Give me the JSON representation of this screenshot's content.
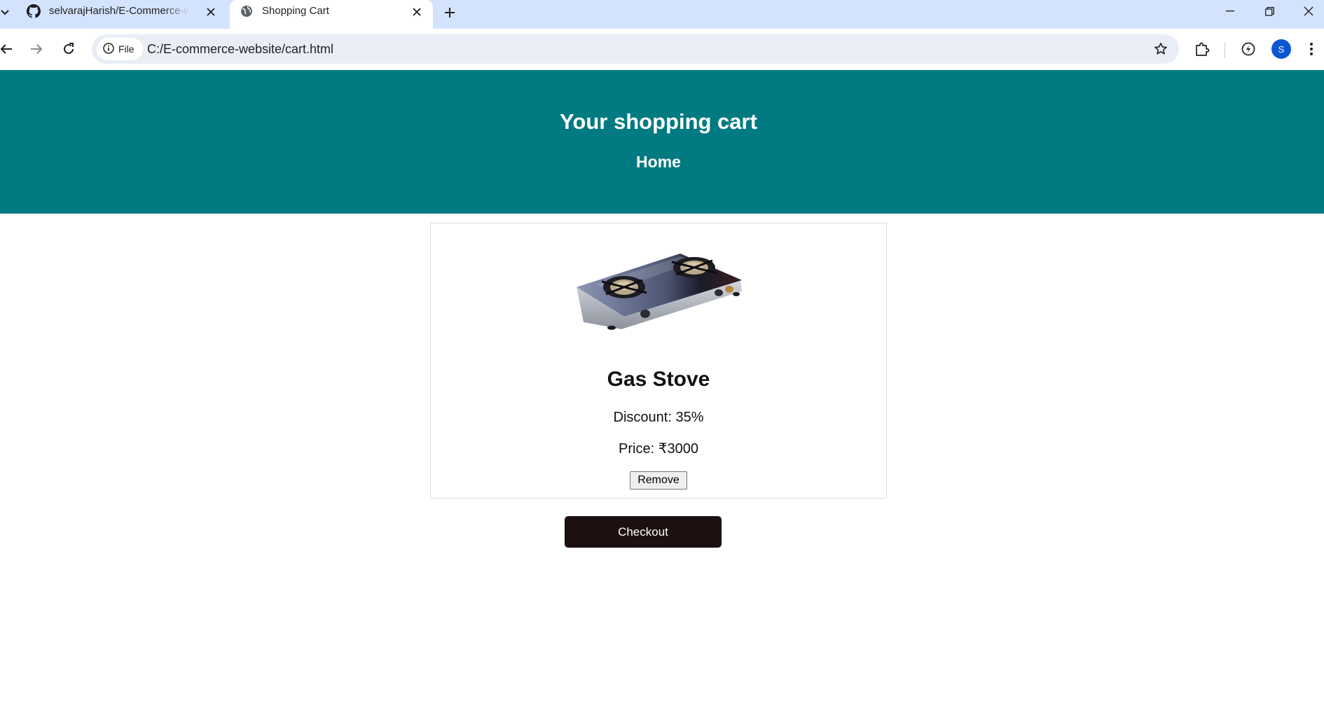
{
  "browser": {
    "tabs": [
      {
        "title": "selvarajHarish/E-Commerce-website",
        "favicon": "github-icon",
        "active": false
      },
      {
        "title": "Shopping Cart",
        "favicon": "globe-icon",
        "active": true
      }
    ],
    "address_bar": {
      "security_chip": "File",
      "url": "C:/E-commerce-website/cart.html"
    },
    "profile_initial": "S",
    "colors": {
      "tabstrip": "#d3e3fd",
      "omnibox": "#e9eef6",
      "avatar": "#0b57d0"
    }
  },
  "header": {
    "title": "Your shopping cart",
    "nav_home": "Home",
    "background": "#017a81"
  },
  "cart": {
    "items": [
      {
        "name": "Gas Stove",
        "discount": "Discount: 35%",
        "price": "Price: ₹3000",
        "remove_label": "Remove",
        "image": "gas-stove-image"
      }
    ],
    "checkout_label": "Checkout",
    "checkout_color": "#1c1010"
  }
}
